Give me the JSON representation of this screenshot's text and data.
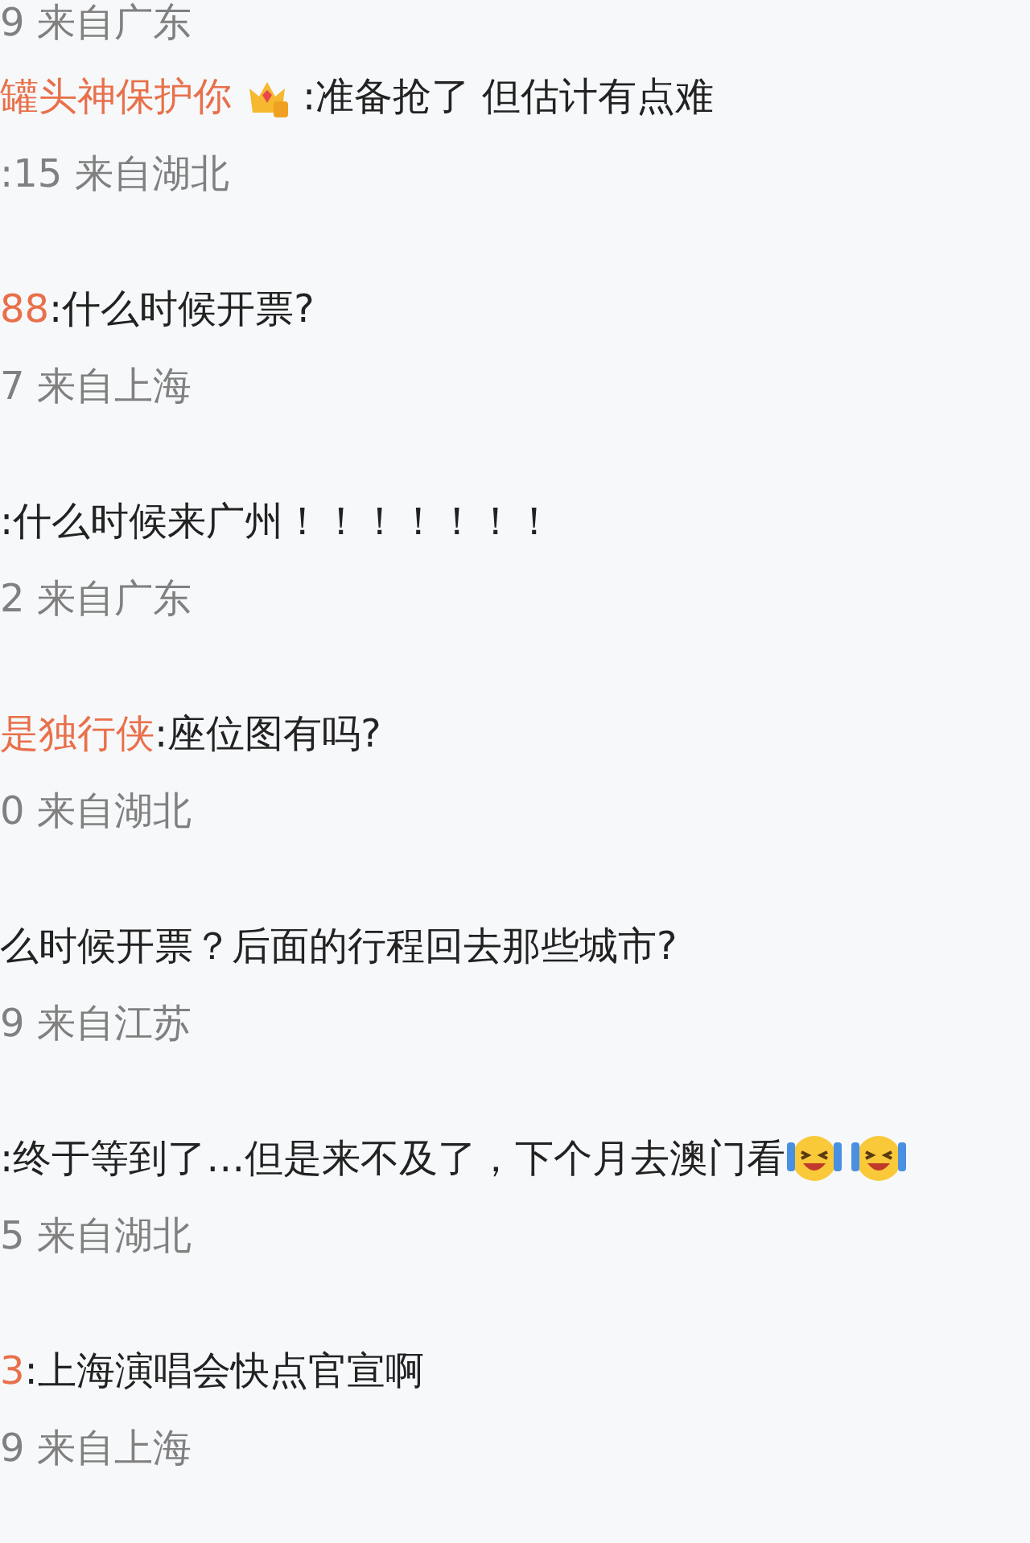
{
  "top_meta": "9 来自广东",
  "comments": [
    {
      "user": "罐头神保护你",
      "badge": {
        "kind": "crown"
      },
      "text": ":准备抢了 但估计有点难",
      "meta": ":15 来自湖北"
    },
    {
      "user": "88",
      "text": ":什么时候开票?",
      "meta": "7 来自上海"
    },
    {
      "text": ":什么时候来广州！！！！！！！",
      "meta": "2 来自广东"
    },
    {
      "user": "是独行侠",
      "text": ":座位图有吗?",
      "meta": "0 来自湖北"
    },
    {
      "text": "么时候开票？后面的行程回去那些城市?",
      "meta": "9 来自江苏"
    },
    {
      "text": ":终于等到了…但是来不及了，下个月去澳门看",
      "emojis": [
        {
          "kind": "crying-laughing"
        },
        {
          "kind": "crying-laughing"
        }
      ],
      "meta": "5 来自湖北"
    },
    {
      "user": "3",
      "text": ":上海演唱会快点官宣啊",
      "meta": "9 来自上海"
    }
  ]
}
